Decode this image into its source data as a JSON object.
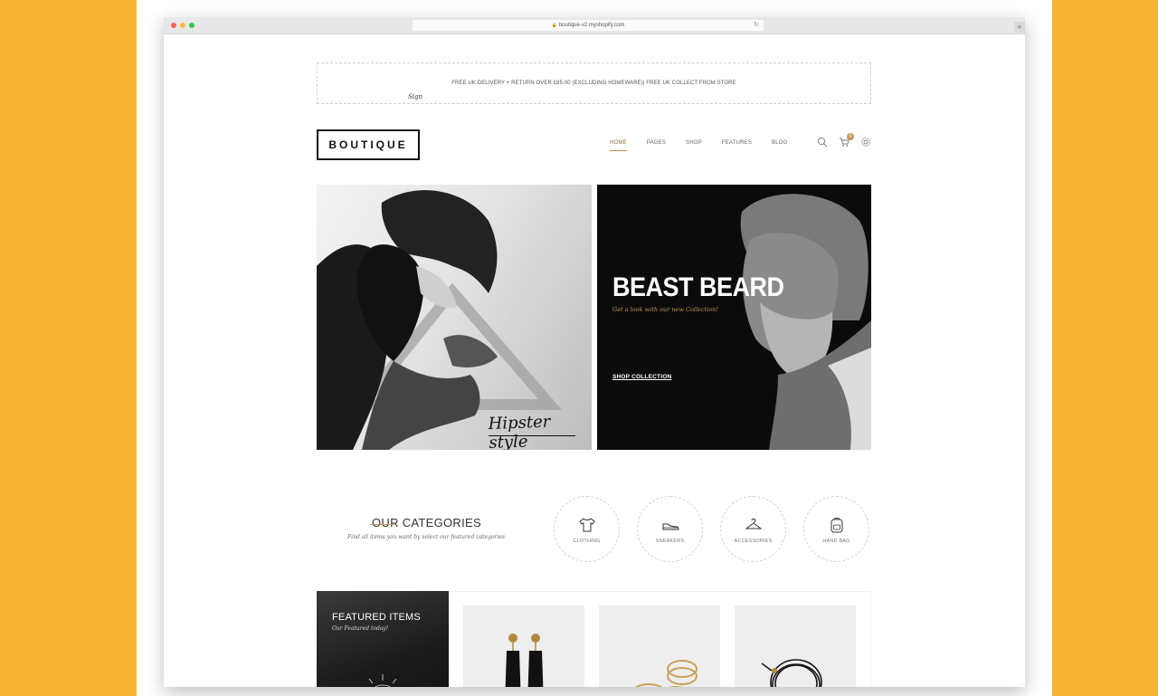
{
  "browser": {
    "url": "boutique-v2.myshopify.com"
  },
  "promo": {
    "text": "FREE UK DELIVERY + RETURN OVER £85.00 (EXCLUDING HOMEWARE)| FREE UK COLLECT FROM STORE",
    "signature": "Sign"
  },
  "header": {
    "logo": "BOUTIQUE",
    "nav": [
      {
        "label": "HOME"
      },
      {
        "label": "PAGES"
      },
      {
        "label": "SHOP"
      },
      {
        "label": "FEATURES"
      },
      {
        "label": "BLOG"
      }
    ],
    "cart_count": "0"
  },
  "hero": {
    "left_script": "Hipster style",
    "right_title": "BEAST BEARD",
    "right_subtitle": "Get a look with our new Collection!",
    "right_link": "SHOP COLLECTION"
  },
  "categories": {
    "title": "OUR CATEGORIES",
    "subtitle": "Find all items you want by select our featured categories",
    "items": [
      {
        "label": "CLOTHING",
        "icon": "tshirt-icon"
      },
      {
        "label": "SNEAKERS",
        "icon": "sneaker-icon"
      },
      {
        "label": "ACCESSORIES",
        "icon": "hanger-icon"
      },
      {
        "label": "HAND BAG",
        "icon": "backpack-icon"
      }
    ]
  },
  "featured": {
    "title": "FEATURED ITEMS",
    "subtitle": "Our Featured today!"
  },
  "colors": {
    "page_background": "#F7B534",
    "accent": "#C7965A",
    "dark": "#0B0B0B"
  }
}
